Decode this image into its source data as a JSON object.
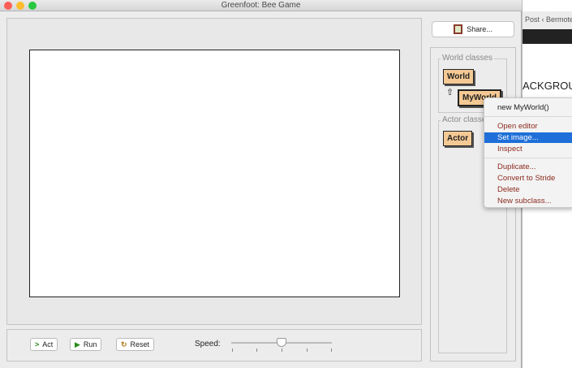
{
  "window": {
    "title": "Greenfoot: Bee Game"
  },
  "background_window": {
    "tab": "Post ‹ Bermote",
    "heading": "ACKGROU"
  },
  "controls": {
    "act": "Act",
    "run": "Run",
    "reset": "Reset",
    "speed_label": "Speed:",
    "speed_value_percent": 50
  },
  "share": {
    "label": "Share..."
  },
  "classes": {
    "world_label": "World classes",
    "world": "World",
    "myworld": "MyWorld",
    "actor_label": "Actor classes",
    "actor": "Actor"
  },
  "menu": {
    "items": [
      "new MyWorld()",
      "Open editor",
      "Set image...",
      "Inspect",
      "Duplicate...",
      "Convert to Stride",
      "Delete",
      "New subclass..."
    ],
    "selected": "Set image..."
  },
  "colors": {
    "class_fill": "#f4c994",
    "menu_highlight": "#1f6fd9",
    "menu_text": "#8b2a1e"
  }
}
